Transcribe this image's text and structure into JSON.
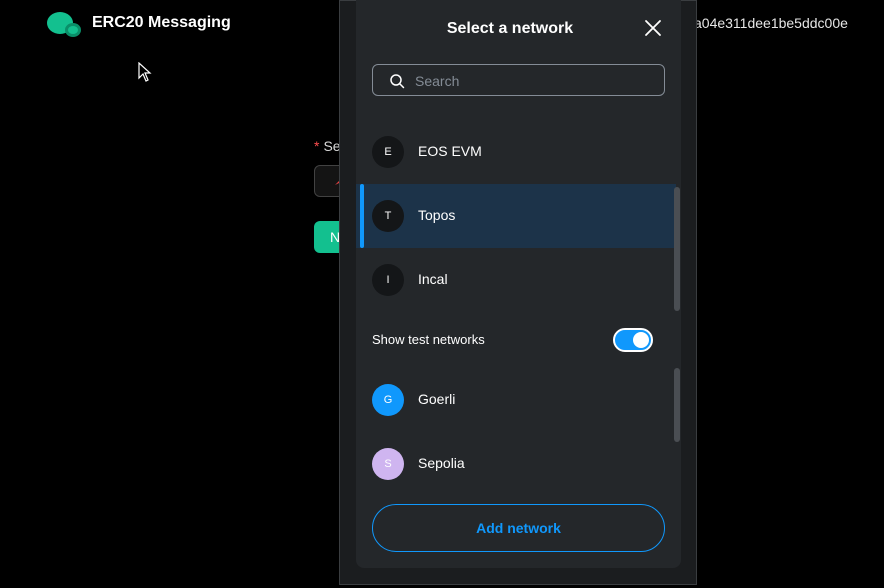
{
  "app": {
    "title": "ERC20 Messaging",
    "address": "a04e311dee1be5ddc00e",
    "brand_color": "#13c08f"
  },
  "form": {
    "field_label": "Se",
    "required_mark": "*",
    "next_label": "N"
  },
  "modal": {
    "title": "Select a network",
    "search": {
      "placeholder": "Search",
      "value": ""
    },
    "networks": [
      {
        "initial": "E",
        "name": "EOS EVM",
        "selected": false
      },
      {
        "initial": "T",
        "name": "Topos",
        "selected": true
      },
      {
        "initial": "I",
        "name": "Incal",
        "selected": false
      }
    ],
    "show_test_label": "Show test networks",
    "show_test_enabled": true,
    "test_networks": [
      {
        "initial": "G",
        "name": "Goerli",
        "color": "#1098fc"
      },
      {
        "initial": "S",
        "name": "Sepolia",
        "color": "#cfb5f0"
      }
    ],
    "add_network_label": "Add network",
    "accent": "#1098fc"
  },
  "icons": {
    "logo": "logo-icon",
    "close": "close-icon",
    "search": "search-icon",
    "cursor": "cursor-icon"
  }
}
